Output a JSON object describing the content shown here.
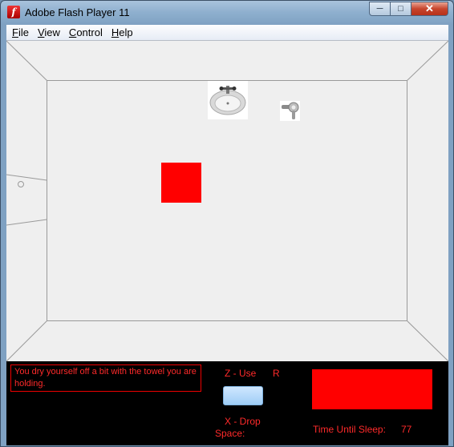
{
  "window": {
    "title": "Adobe Flash Player 11",
    "app_icon_glyph": "f",
    "minimize_glyph": "─",
    "maximize_glyph": "□",
    "close_glyph": "✕"
  },
  "menu": {
    "items": [
      {
        "key": "F",
        "rest": "ile"
      },
      {
        "key": "V",
        "rest": "iew"
      },
      {
        "key": "C",
        "rest": "ontrol"
      },
      {
        "key": "H",
        "rest": "elp"
      }
    ]
  },
  "room": {
    "objects": [
      "sink-icon",
      "hair-dryer-icon",
      "player-square"
    ],
    "player_color": "#ff0000"
  },
  "hud": {
    "message": "You dry yourself off a bit with the towel you are holding.",
    "use_label": "Z - Use",
    "use_key_hint": "R",
    "drop_label": "X - Drop",
    "space_label": "Space:",
    "held_item": "towel-icon",
    "sleep_label": "Time Until Sleep:",
    "sleep_value": "77",
    "sleep_bar_color": "#ff0000",
    "text_color": "#ff2a2a"
  }
}
